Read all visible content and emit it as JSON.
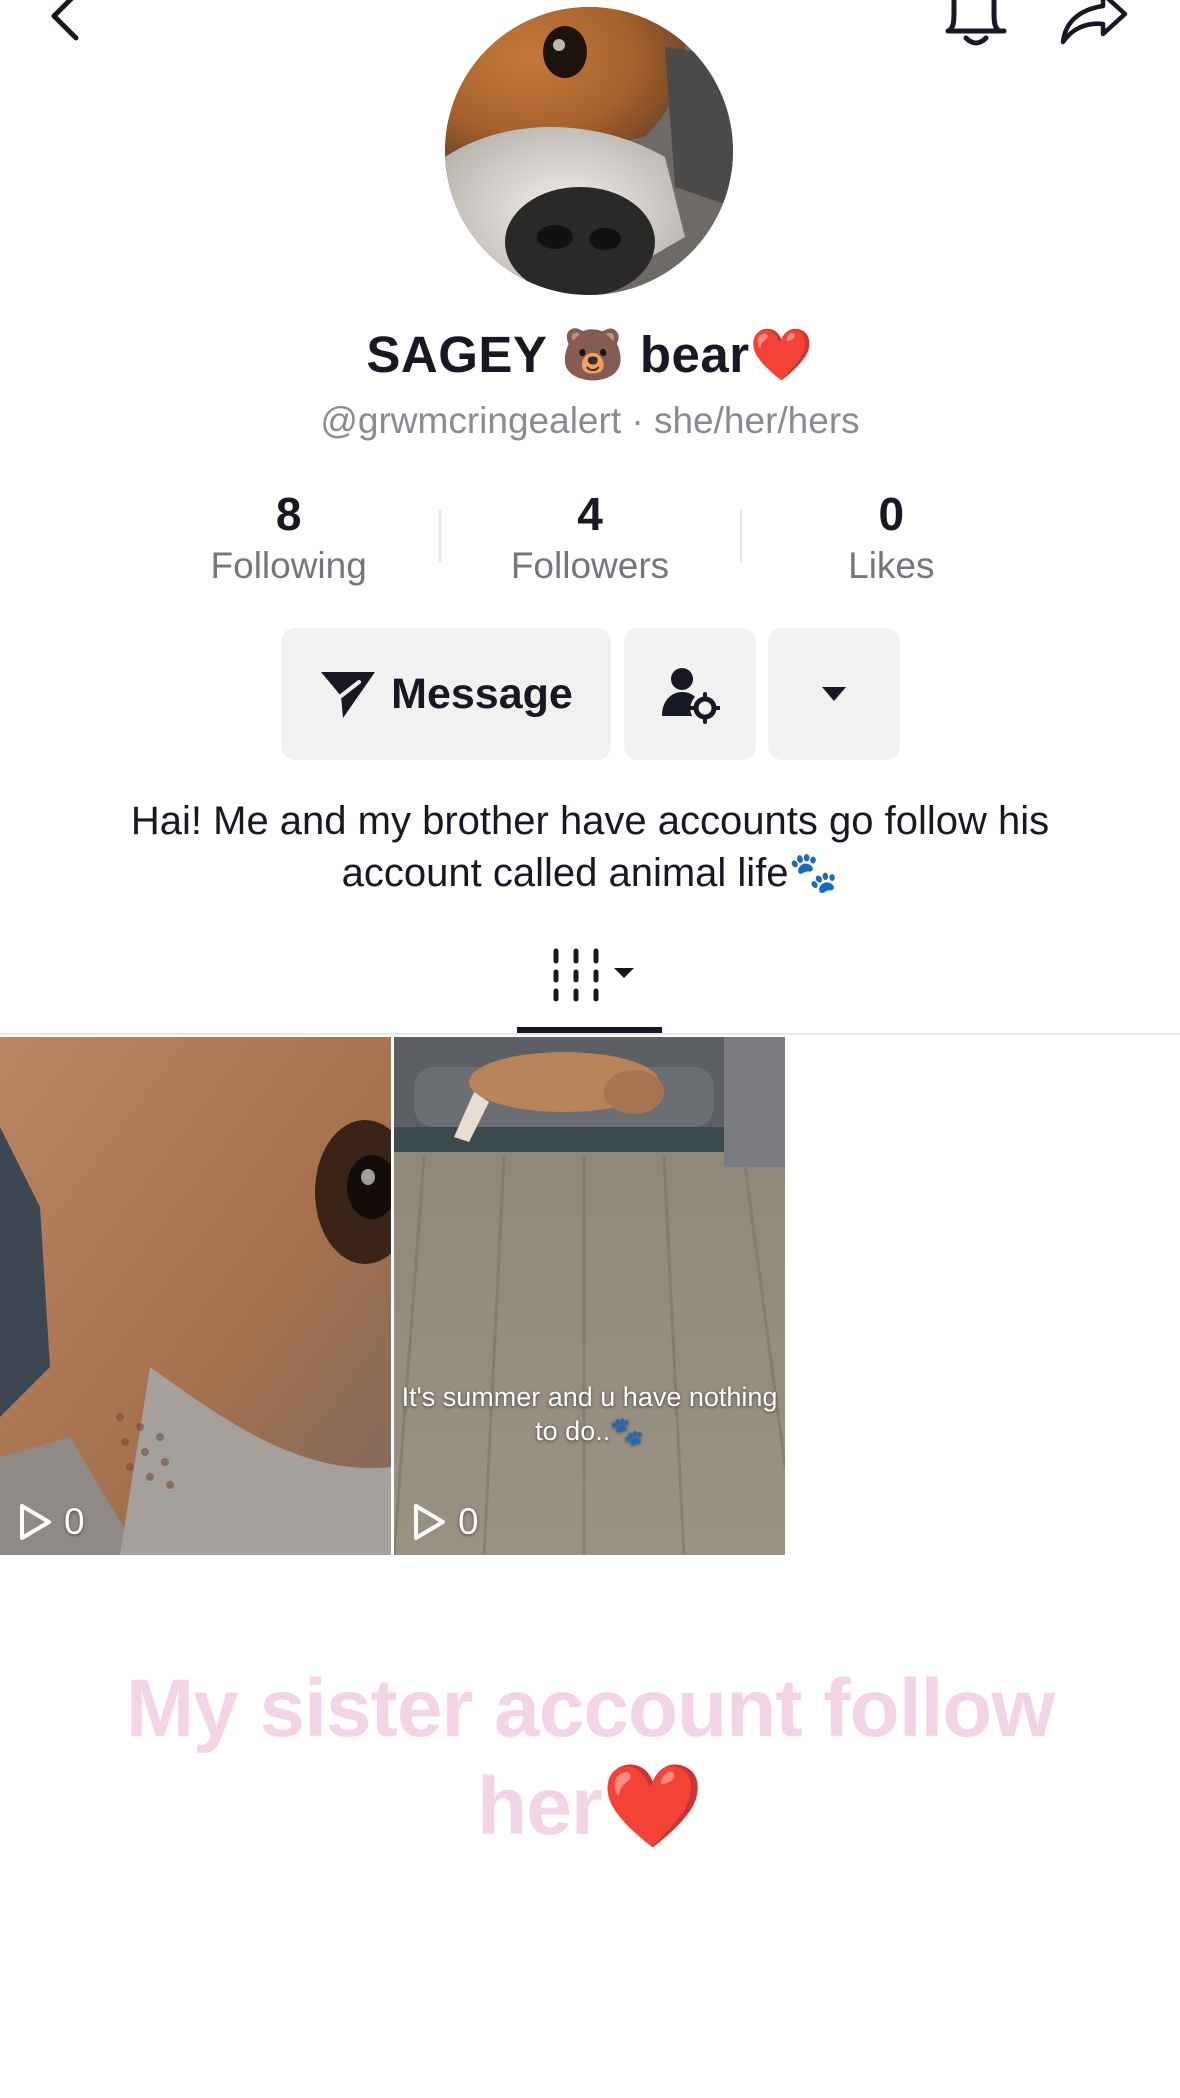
{
  "profile": {
    "display_name": "SAGEY 🐻 bear❤️",
    "handle_line": "@grwmcringealert · she/her/hers",
    "bio": "Hai! Me and my brother have accounts go follow his account called animal life🐾"
  },
  "stats": [
    {
      "value": "8",
      "label": "Following"
    },
    {
      "value": "4",
      "label": "Followers"
    },
    {
      "value": "0",
      "label": "Likes"
    }
  ],
  "actions": {
    "message_label": "Message"
  },
  "videos": [
    {
      "views": "0",
      "caption": ""
    },
    {
      "views": "0",
      "caption": "It's summer and u have nothing to do..🐾"
    }
  ],
  "promo_text": "My sister account follow her❤️",
  "icons": {
    "back": "chevron-left-icon",
    "notifications": "bell-icon",
    "share": "share-arrow-icon",
    "message": "send-icon",
    "add_friend": "person-settings-icon",
    "more": "caret-down-icon",
    "videos_tab": "grid-bars-icon",
    "play": "play-icon"
  },
  "colors": {
    "text": "#161823",
    "muted": "#8a8b91",
    "button_bg": "#f1f1f2",
    "promo": "#f3d3e6"
  }
}
